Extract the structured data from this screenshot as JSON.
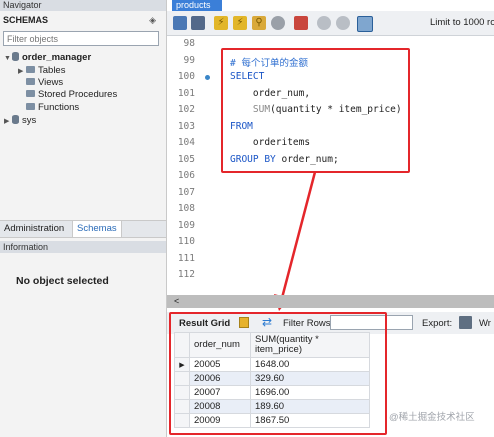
{
  "navigator": {
    "title": "Navigator",
    "schemas_header": "SCHEMAS",
    "schemas_controls": "◈",
    "filter_placeholder": "Filter objects",
    "tree": [
      {
        "label": "order_manager",
        "expanded": true
      },
      {
        "label": "Tables"
      },
      {
        "label": "Views"
      },
      {
        "label": "Stored Procedures"
      },
      {
        "label": "Functions"
      },
      {
        "label": "sys",
        "expanded": false
      }
    ],
    "tabs": [
      "Administration",
      "Schemas"
    ],
    "info_title": "Information",
    "no_object": "No object selected"
  },
  "editor": {
    "tab_label": "products",
    "limit_label": "Limit to 1000 rows",
    "lines": [
      {
        "num": "98",
        "code": ""
      },
      {
        "num": "99",
        "code": "# 每个订单的金额",
        "type": "comment"
      },
      {
        "num": "100",
        "code": "SELECT",
        "type": "keyword",
        "bullet": true
      },
      {
        "num": "101",
        "code": "    order_num,"
      },
      {
        "num": "102",
        "fn": "SUM",
        "code": "(quantity * item_price)"
      },
      {
        "num": "103",
        "code": "FROM",
        "type": "keyword"
      },
      {
        "num": "104",
        "code": "    orderitems"
      },
      {
        "num": "105",
        "kw": "GROUP BY",
        "code": " order_num;"
      },
      {
        "num": "106",
        "code": ""
      },
      {
        "num": "107",
        "code": ""
      },
      {
        "num": "108",
        "code": ""
      },
      {
        "num": "109",
        "code": ""
      },
      {
        "num": "110",
        "code": ""
      },
      {
        "num": "111",
        "code": ""
      },
      {
        "num": "112",
        "code": ""
      }
    ],
    "scroll_arrow": "<"
  },
  "results": {
    "result_grid_label": "Result Grid",
    "filter_rows_label": "Filter Rows:",
    "export_label": "Export:",
    "wrap_label": "Wr",
    "columns": [
      "order_num",
      "SUM(quantity *",
      "item_price)"
    ],
    "rows": [
      [
        "20005",
        "1648.00"
      ],
      [
        "20006",
        "329.60"
      ],
      [
        "20007",
        "1696.00"
      ],
      [
        "20008",
        "189.60"
      ],
      [
        "20009",
        "1867.50"
      ]
    ]
  },
  "watermark": "@稀土掘金技术社区",
  "colors": {
    "highlight_box": "#e4262b",
    "tab_active": "#3b7fd8",
    "keyword": "#1a55c6"
  }
}
